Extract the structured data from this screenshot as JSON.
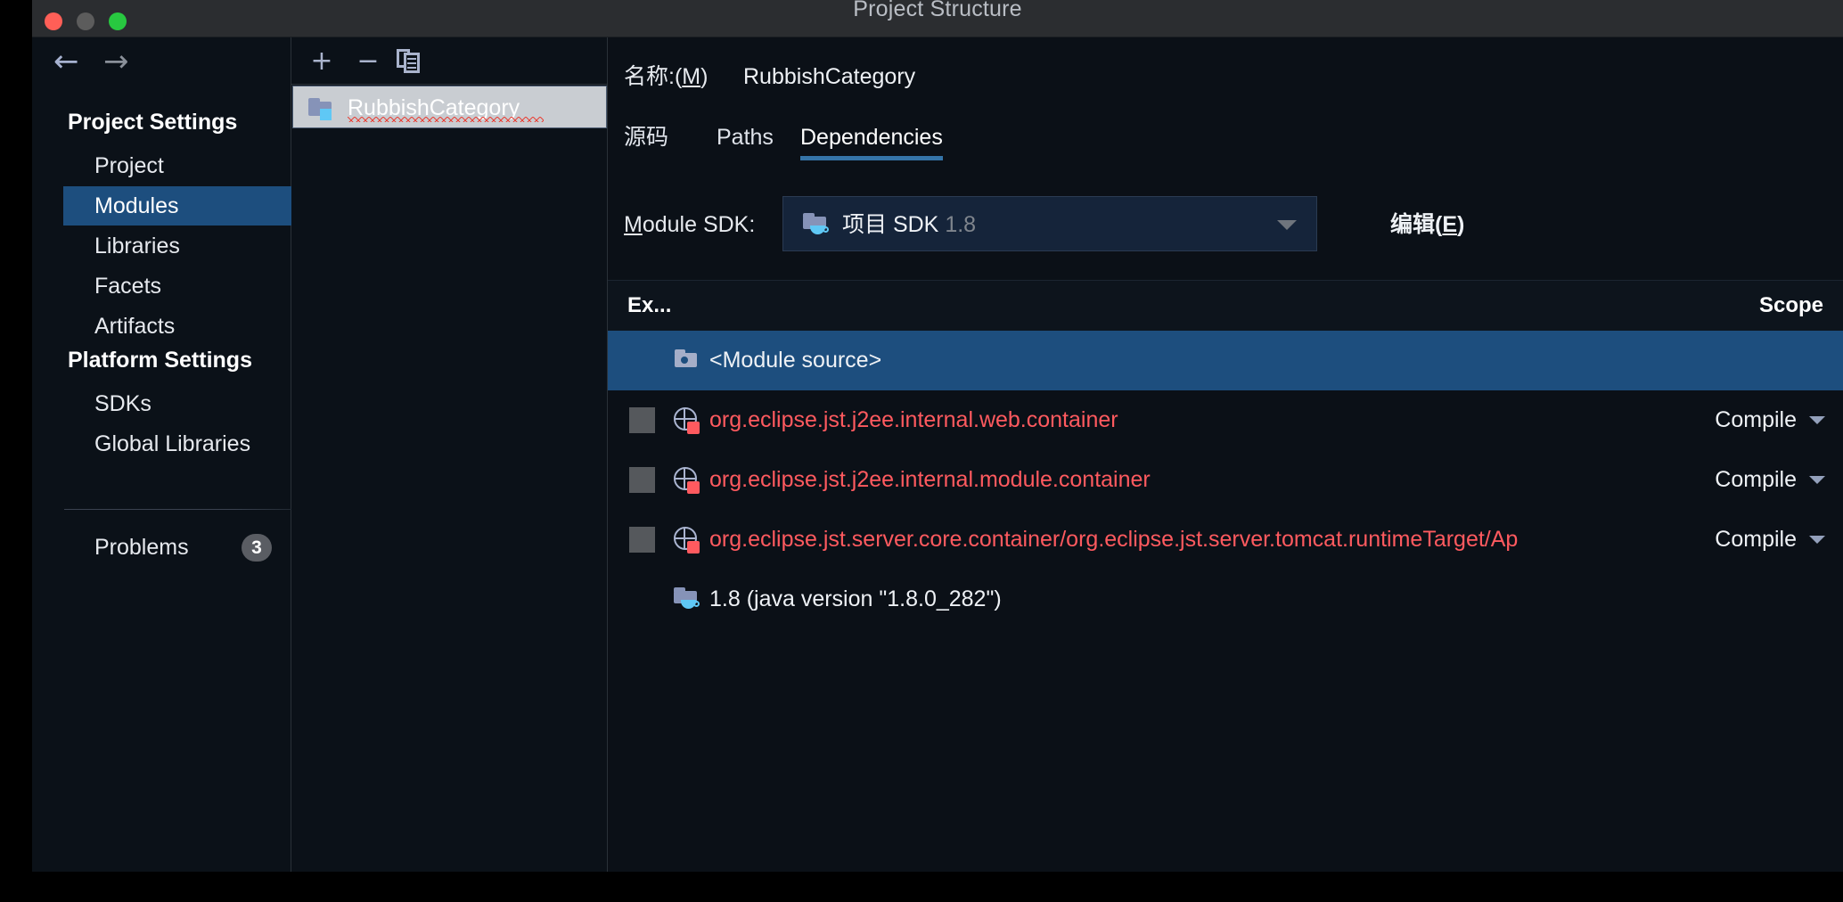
{
  "window": {
    "title": "Project Structure",
    "traffic_lights": [
      "close-button",
      "minimize-button",
      "maximize-button"
    ]
  },
  "sidebar": {
    "nav": {
      "back_icon": "arrow-left-icon",
      "forward_icon": "arrow-right-icon"
    },
    "groups": [
      {
        "title": "Project Settings",
        "items": [
          {
            "label": "Project",
            "selected": false
          },
          {
            "label": "Modules",
            "selected": true
          },
          {
            "label": "Libraries",
            "selected": false
          },
          {
            "label": "Facets",
            "selected": false
          },
          {
            "label": "Artifacts",
            "selected": false
          }
        ]
      },
      {
        "title": "Platform Settings",
        "items": [
          {
            "label": "SDKs",
            "selected": false
          },
          {
            "label": "Global Libraries",
            "selected": false
          }
        ]
      }
    ],
    "problems": {
      "label": "Problems",
      "count": "3"
    }
  },
  "modules_panel": {
    "toolbar": {
      "add_label": "+",
      "remove_label": "−",
      "copy_icon": "copy-icon"
    },
    "items": [
      {
        "label": "RubbishCategory",
        "selected": true,
        "icon": "module-folder-icon",
        "has_spellcheck_underline": true
      }
    ]
  },
  "details": {
    "name_label": "名称:(",
    "name_mnemonic": "M",
    "name_label_end": ")",
    "name_value": "RubbishCategory",
    "tabs": [
      {
        "label": "源码",
        "active": false
      },
      {
        "label": "Paths",
        "active": false
      },
      {
        "label": "Dependencies",
        "active": true
      }
    ],
    "sdk": {
      "label_start": "",
      "label_mnemonic": "M",
      "label_end": "odule SDK:",
      "value": "项目 SDK",
      "version": "1.8",
      "icon": "jdk-folder-icon",
      "dropdown_icon": "chevron-down-icon",
      "edit_start": "编辑(",
      "edit_mnemonic": "E",
      "edit_end": ")"
    },
    "table": {
      "columns": [
        "Ex...",
        "Scope"
      ],
      "rows": [
        {
          "name": "<Module source>",
          "scope": "",
          "selected": true,
          "error": false,
          "icon": "module-source-folder-icon",
          "has_checkbox": false,
          "has_scope_dropdown": false
        },
        {
          "name": "org.eclipse.jst.j2ee.internal.web.container",
          "scope": "Compile",
          "selected": false,
          "error": true,
          "icon": "library-globe-error-icon",
          "has_checkbox": true,
          "has_scope_dropdown": true
        },
        {
          "name": "org.eclipse.jst.j2ee.internal.module.container",
          "scope": "Compile",
          "selected": false,
          "error": true,
          "icon": "library-globe-error-icon",
          "has_checkbox": true,
          "has_scope_dropdown": true
        },
        {
          "name": "org.eclipse.jst.server.core.container/org.eclipse.jst.server.tomcat.runtimeTarget/Ap",
          "scope": "Compile",
          "selected": false,
          "error": true,
          "icon": "library-globe-error-icon",
          "has_checkbox": true,
          "has_scope_dropdown": true
        },
        {
          "name": "1.8 (java version \"1.8.0_282\")",
          "scope": "",
          "selected": false,
          "error": false,
          "icon": "jdk-folder-icon",
          "has_checkbox": false,
          "has_scope_dropdown": false
        }
      ]
    }
  },
  "colors": {
    "accent": "#3574a8",
    "selection": "#1d4e7e",
    "error": "#ff5a5f",
    "panel_bg": "#0b1017"
  }
}
